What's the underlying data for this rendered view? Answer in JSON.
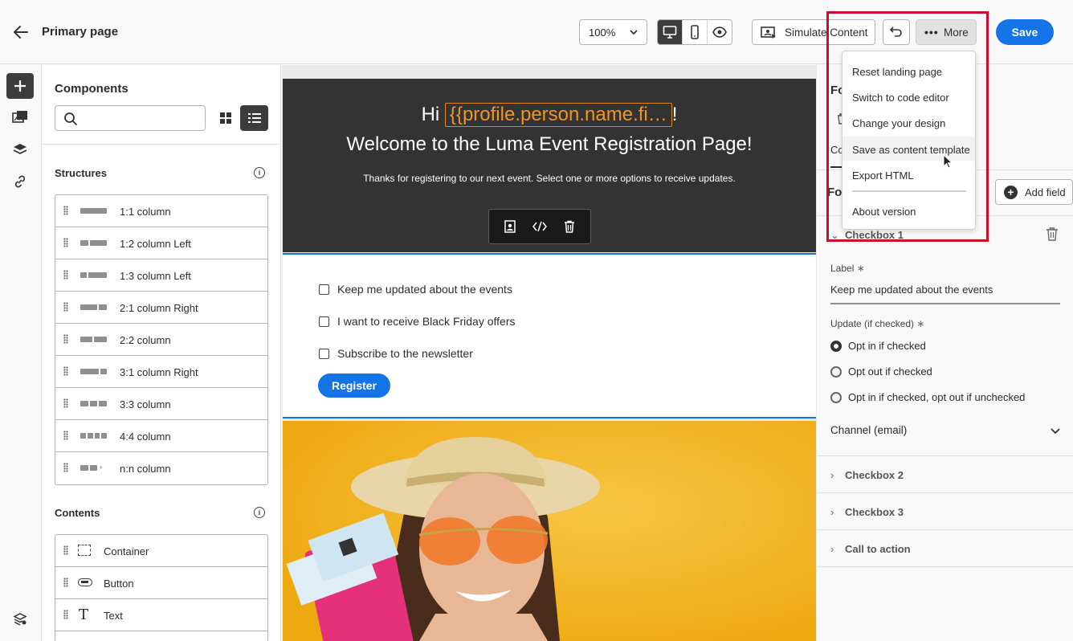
{
  "header": {
    "title": "Primary page",
    "zoom": "100%",
    "simulate_label": "Simulate Content",
    "more_label": "More",
    "save_label": "Save"
  },
  "components": {
    "title": "Components",
    "search_placeholder": "",
    "structures_title": "Structures",
    "structures": [
      "1:1 column",
      "1:2 column Left",
      "1:3 column Left",
      "2:1 column Right",
      "2:2 column",
      "3:1 column Right",
      "3:3 column",
      "4:4 column",
      "n:n column"
    ],
    "contents_title": "Contents",
    "contents": [
      "Container",
      "Button",
      "Text"
    ]
  },
  "canvas": {
    "greeting_prefix": "Hi",
    "greeting_tag": "{{profile.person.name.fi…",
    "greeting_suffix": "!",
    "welcome": "Welcome to the Luma Event Registration Page!",
    "thanks": "Thanks for registering to our next event. Select one or more options to receive updates.",
    "checkboxes": [
      "Keep me updated about the events",
      "I want to receive Black Friday offers",
      "Subscribe to the newsletter"
    ],
    "register_label": "Register"
  },
  "right_panel": {
    "heading_partial": "Fo",
    "tab_partial": "Co",
    "form_partial": "Fo",
    "add_field_label": "Add field",
    "checkbox1_title": "Checkbox 1",
    "label_title": "Label",
    "label_value": "Keep me updated about the events",
    "update_title": "Update (if checked)",
    "options": [
      "Opt in if checked",
      "Opt out if checked",
      "Opt in if checked, opt out if unchecked"
    ],
    "channel_label": "Channel (email)",
    "sections": [
      "Checkbox 2",
      "Checkbox 3",
      "Call to action"
    ]
  },
  "more_menu": {
    "items": [
      "Reset landing page",
      "Switch to code editor",
      "Change your design",
      "Save as content template",
      "Export HTML"
    ],
    "about": "About version"
  },
  "colors": {
    "accent": "#1473e6",
    "highlight": "#c8102e",
    "hero_bg": "#333333",
    "photo_bg": "#f2b21b"
  }
}
